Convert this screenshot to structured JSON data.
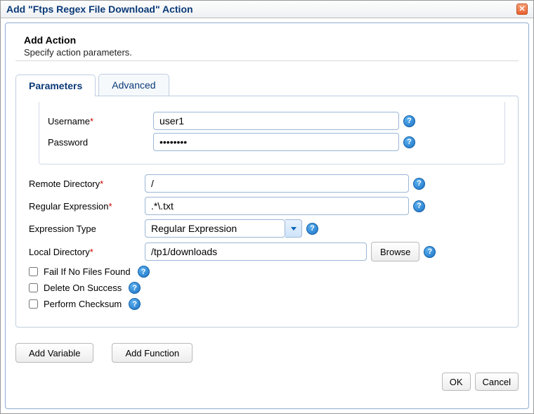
{
  "window": {
    "title": "Add \"Ftps Regex File Download\" Action"
  },
  "header": {
    "title": "Add Action",
    "subtitle": "Specify action parameters."
  },
  "tabs": {
    "parameters": "Parameters",
    "advanced": "Advanced"
  },
  "labels": {
    "username": "Username",
    "password": "Password",
    "remote_directory": "Remote Directory",
    "regular_expression": "Regular Expression",
    "expression_type": "Expression Type",
    "local_directory": "Local Directory",
    "fail_if_no_files": "Fail If No Files Found",
    "delete_on_success": "Delete On Success",
    "perform_checksum": "Perform Checksum"
  },
  "values": {
    "username": "user1",
    "password": "••••••••",
    "remote_directory": "/",
    "regular_expression": ".*\\.txt",
    "expression_type": "Regular Expression",
    "local_directory": "/tp1/downloads"
  },
  "buttons": {
    "browse": "Browse",
    "add_variable": "Add Variable",
    "add_function": "Add Function",
    "ok": "OK",
    "cancel": "Cancel"
  },
  "required_marker": "*"
}
